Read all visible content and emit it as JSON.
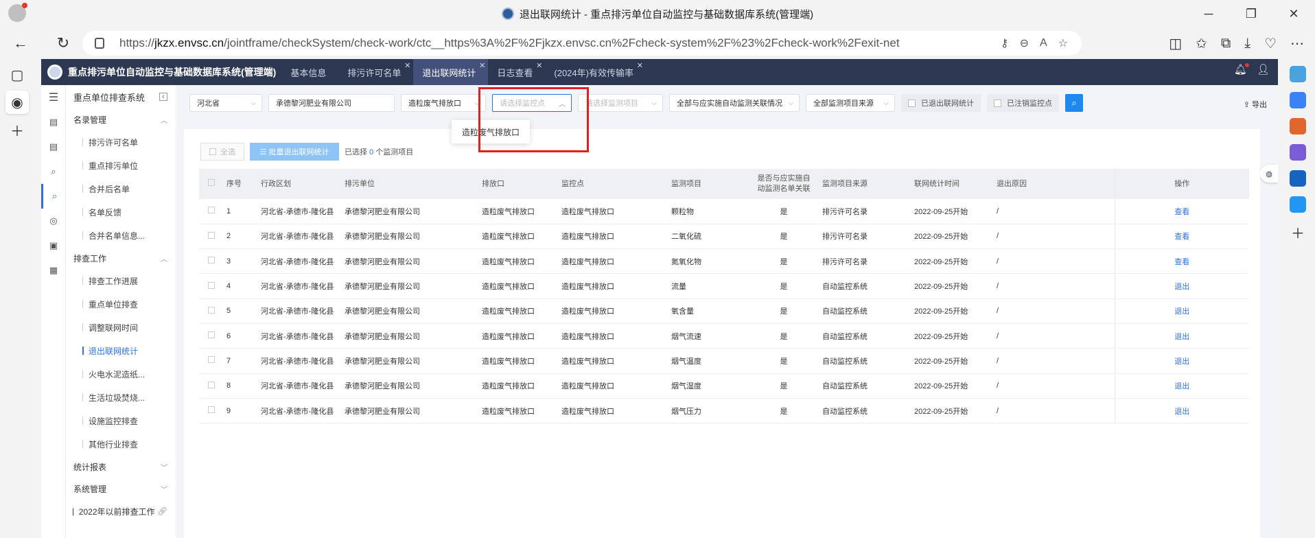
{
  "browser": {
    "title": "退出联网统计 - 重点排污单位自动监控与基础数据库系统(管理端)",
    "url_prefix": "https://",
    "url_host": "jkzx.envsc.cn",
    "url_path": "/jointframe/checkSystem/check-work/ctc__https%3A%2F%2Fjkzx.envsc.cn%2Fcheck-system%2F%23%2Fcheck-work%2Fexit-net"
  },
  "app": {
    "system_title": "重点排污单位自动监控与基础数据库系统(管理端)",
    "tabs": [
      {
        "label": "基本信息"
      },
      {
        "label": "排污许可名单"
      },
      {
        "label": "退出联网统计"
      },
      {
        "label": "日志查看"
      },
      {
        "label": "(2024年)有效传输率"
      }
    ]
  },
  "sidebar": {
    "heading": "重点单位排查系统",
    "group1": "名录管理",
    "group1_items": [
      "排污许可名单",
      "重点排污单位",
      "合并后名单",
      "名单反馈",
      "合并名单信息..."
    ],
    "group2": "排查工作",
    "group2_items": [
      "排查工作进展",
      "重点单位排查",
      "调整联网时间",
      "退出联网统计",
      "火电水泥造纸...",
      "生活垃圾焚烧...",
      "设施监控排查",
      "其他行业排查"
    ],
    "group3": "统计报表",
    "group4": "系统管理",
    "footer": "2022年以前排查工作"
  },
  "filters": {
    "province": "河北省",
    "company": "承德黎河肥业有限公司",
    "outlet": "造粒废气排放口",
    "monitor_point_placeholder": "请选择监控点",
    "monitor_item_placeholder": "请选择监测项目",
    "relation": "全部与应实施自动监测关联情况",
    "source": "全部监测项目来源",
    "check1": "已退出联网统计",
    "check2": "已注销监控点",
    "export": "导出"
  },
  "dropdown": {
    "option": "造粒废气排放口"
  },
  "toolbar": {
    "select_all": "全选",
    "batch": "批量退出联网统计",
    "selected_prefix": "已选择",
    "selected_count": "0",
    "selected_suffix": "个监测项目"
  },
  "table": {
    "headers": [
      "序号",
      "行政区划",
      "排污单位",
      "排放口",
      "监控点",
      "监测项目",
      "是否与应实施自动监测名单关联",
      "监测项目来源",
      "联网统计时间",
      "退出原因",
      "操作"
    ],
    "rows": [
      [
        "1",
        "河北省-承德市-隆化县",
        "承德黎河肥业有限公司",
        "造粒废气排放口",
        "造粒废气排放口",
        "颗粒物",
        "是",
        "排污许可名录",
        "2022-09-25开始",
        "/",
        "查看"
      ],
      [
        "2",
        "河北省-承德市-隆化县",
        "承德黎河肥业有限公司",
        "造粒废气排放口",
        "造粒废气排放口",
        "二氧化硫",
        "是",
        "排污许可名录",
        "2022-09-25开始",
        "/",
        "查看"
      ],
      [
        "3",
        "河北省-承德市-隆化县",
        "承德黎河肥业有限公司",
        "造粒废气排放口",
        "造粒废气排放口",
        "氮氧化物",
        "是",
        "排污许可名录",
        "2022-09-25开始",
        "/",
        "查看"
      ],
      [
        "4",
        "河北省-承德市-隆化县",
        "承德黎河肥业有限公司",
        "造粒废气排放口",
        "造粒废气排放口",
        "流量",
        "是",
        "自动监控系统",
        "2022-09-25开始",
        "/",
        "退出"
      ],
      [
        "5",
        "河北省-承德市-隆化县",
        "承德黎河肥业有限公司",
        "造粒废气排放口",
        "造粒废气排放口",
        "氧含量",
        "是",
        "自动监控系统",
        "2022-09-25开始",
        "/",
        "退出"
      ],
      [
        "6",
        "河北省-承德市-隆化县",
        "承德黎河肥业有限公司",
        "造粒废气排放口",
        "造粒废气排放口",
        "烟气流速",
        "是",
        "自动监控系统",
        "2022-09-25开始",
        "/",
        "退出"
      ],
      [
        "7",
        "河北省-承德市-隆化县",
        "承德黎河肥业有限公司",
        "造粒废气排放口",
        "造粒废气排放口",
        "烟气温度",
        "是",
        "自动监控系统",
        "2022-09-25开始",
        "/",
        "退出"
      ],
      [
        "8",
        "河北省-承德市-隆化县",
        "承德黎河肥业有限公司",
        "造粒废气排放口",
        "造粒废气排放口",
        "烟气湿度",
        "是",
        "自动监控系统",
        "2022-09-25开始",
        "/",
        "退出"
      ],
      [
        "9",
        "河北省-承德市-隆化县",
        "承德黎河肥业有限公司",
        "造粒废气排放口",
        "造粒废气排放口",
        "烟气压力",
        "是",
        "自动监控系统",
        "2022-09-25开始",
        "/",
        "退出"
      ]
    ]
  }
}
